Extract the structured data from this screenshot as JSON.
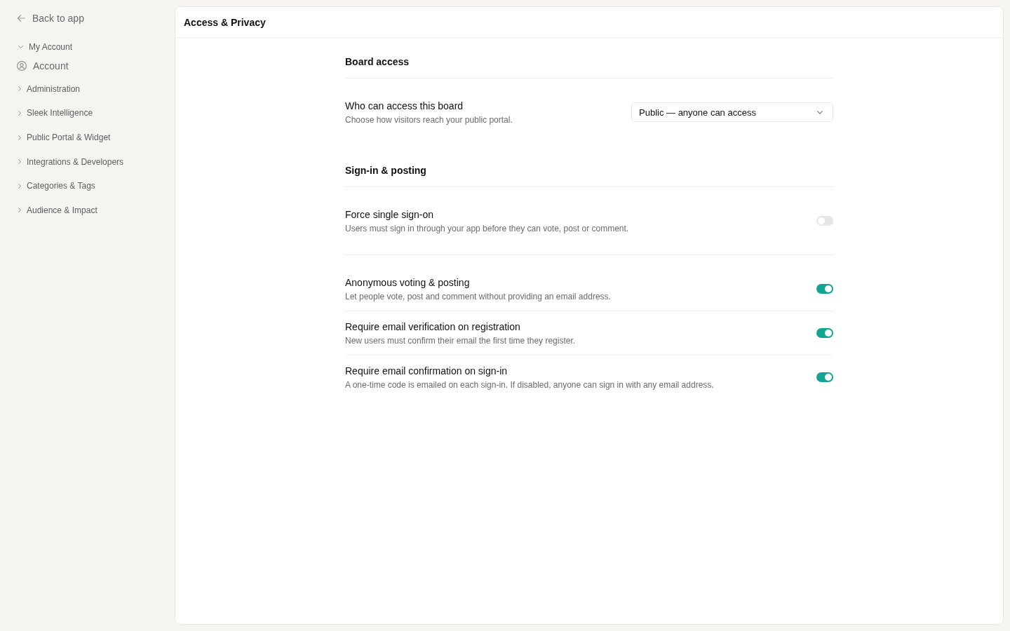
{
  "sidebar": {
    "back_link": {
      "label": "Back to app"
    },
    "groups": [
      {
        "label": "My Account",
        "expanded": true,
        "children": [
          {
            "label": "Account",
            "selected": false
          }
        ]
      },
      {
        "label": "Administration",
        "expanded": false
      },
      {
        "label": "Sleek Intelligence",
        "expanded": false
      },
      {
        "label": "Public Portal & Widget",
        "expanded": false
      },
      {
        "label": "Integrations & Developers",
        "expanded": false
      },
      {
        "label": "Categories & Tags",
        "expanded": false
      },
      {
        "label": "Audience & Impact",
        "expanded": false
      }
    ]
  },
  "page": {
    "title": "Access & Privacy"
  },
  "sections": [
    {
      "title": "Board access",
      "groups": [
        {
          "settings": [
            {
              "kind": "select",
              "label": "Who can access this board",
              "description": "Choose how visitors reach your public portal.",
              "value": "Public — anyone can access"
            }
          ]
        }
      ]
    },
    {
      "title": "Sign-in & posting",
      "groups": [
        {
          "settings": [
            {
              "kind": "toggle",
              "label": "Force single sign-on",
              "description": "Users must sign in through your app before they can vote, post or comment.",
              "on": false
            }
          ]
        },
        {
          "settings": [
            {
              "kind": "toggle",
              "label": "Anonymous voting & posting",
              "description": "Let people vote, post and comment without providing an email address.",
              "on": true
            },
            {
              "kind": "toggle",
              "label": "Require email verification on registration",
              "description": "New users must confirm their email the first time they register.",
              "on": true
            },
            {
              "kind": "toggle",
              "label": "Require email confirmation on sign-in",
              "description": "A one-time code is emailed on each sign-in. If disabled, anyone can sign in with any email address.",
              "on": true
            }
          ]
        }
      ]
    }
  ]
}
